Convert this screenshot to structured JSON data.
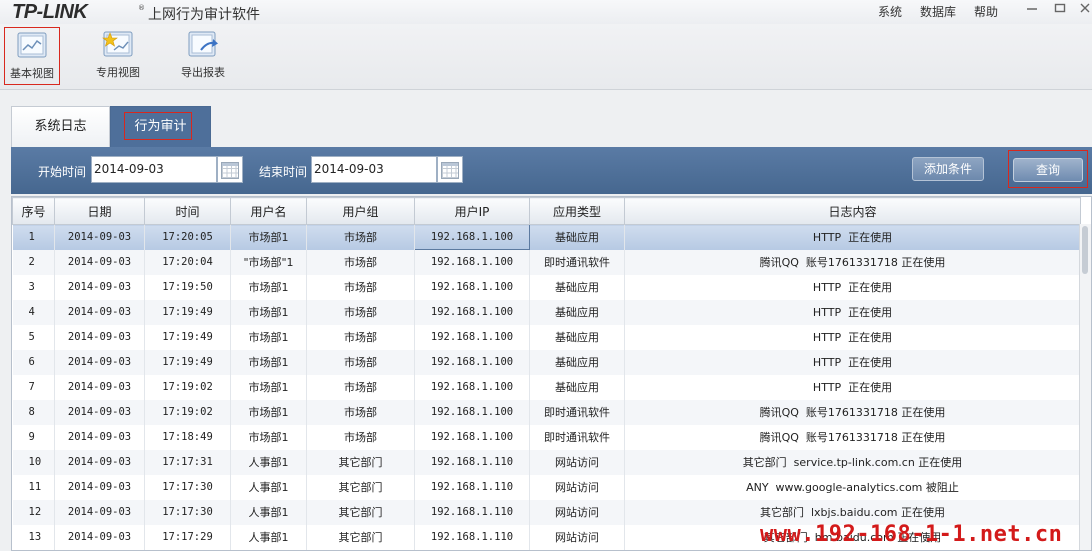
{
  "app": {
    "logo": "TP-LINK",
    "logo_mark": "®",
    "title": "上网行为审计软件",
    "menu": [
      "系统",
      "数据库",
      "帮助"
    ]
  },
  "toolbar": {
    "items": [
      {
        "label": "基本视图",
        "icon": "basic-view-icon"
      },
      {
        "label": "专用视图",
        "icon": "custom-view-icon"
      },
      {
        "label": "导出报表",
        "icon": "export-report-icon"
      }
    ]
  },
  "tabs": [
    {
      "label": "系统日志"
    },
    {
      "label": "行为审计"
    }
  ],
  "filter": {
    "start_label": "开始时间",
    "start_value": "2014-09-03",
    "end_label": "结束时间",
    "end_value": "2014-09-03",
    "add_condition": "添加条件",
    "query": "查询"
  },
  "table": {
    "columns": [
      "序号",
      "日期",
      "时间",
      "用户名",
      "用户组",
      "用户IP",
      "应用类型",
      "日志内容"
    ],
    "rows": [
      [
        "1",
        "2014-09-03",
        "17:20:05",
        "市场部1",
        "市场部",
        "192.168.1.100",
        "基础应用",
        "HTTP  正在使用"
      ],
      [
        "2",
        "2014-09-03",
        "17:20:04",
        "\"市场部\"1",
        "市场部",
        "192.168.1.100",
        "即时通讯软件",
        "腾讯QQ  账号1761331718 正在使用"
      ],
      [
        "3",
        "2014-09-03",
        "17:19:50",
        "市场部1",
        "市场部",
        "192.168.1.100",
        "基础应用",
        "HTTP  正在使用"
      ],
      [
        "4",
        "2014-09-03",
        "17:19:49",
        "市场部1",
        "市场部",
        "192.168.1.100",
        "基础应用",
        "HTTP  正在使用"
      ],
      [
        "5",
        "2014-09-03",
        "17:19:49",
        "市场部1",
        "市场部",
        "192.168.1.100",
        "基础应用",
        "HTTP  正在使用"
      ],
      [
        "6",
        "2014-09-03",
        "17:19:49",
        "市场部1",
        "市场部",
        "192.168.1.100",
        "基础应用",
        "HTTP  正在使用"
      ],
      [
        "7",
        "2014-09-03",
        "17:19:02",
        "市场部1",
        "市场部",
        "192.168.1.100",
        "基础应用",
        "HTTP  正在使用"
      ],
      [
        "8",
        "2014-09-03",
        "17:19:02",
        "市场部1",
        "市场部",
        "192.168.1.100",
        "即时通讯软件",
        "腾讯QQ  账号1761331718 正在使用"
      ],
      [
        "9",
        "2014-09-03",
        "17:18:49",
        "市场部1",
        "市场部",
        "192.168.1.100",
        "即时通讯软件",
        "腾讯QQ  账号1761331718 正在使用"
      ],
      [
        "10",
        "2014-09-03",
        "17:17:31",
        "人事部1",
        "其它部门",
        "192.168.1.110",
        "网站访问",
        "其它部门  service.tp-link.com.cn 正在使用"
      ],
      [
        "11",
        "2014-09-03",
        "17:17:30",
        "人事部1",
        "其它部门",
        "192.168.1.110",
        "网站访问",
        "ANY  www.google-analytics.com 被阻止"
      ],
      [
        "12",
        "2014-09-03",
        "17:17:30",
        "人事部1",
        "其它部门",
        "192.168.1.110",
        "网站访问",
        "其它部门  lxbjs.baidu.com 正在使用"
      ],
      [
        "13",
        "2014-09-03",
        "17:17:29",
        "人事部1",
        "其它部门",
        "192.168.1.110",
        "网站访问",
        "其它部门  hm.baidu.com 正在使用"
      ]
    ]
  },
  "watermark": "www.192-168-1-1.net.cn",
  "colors": {
    "accent_blue": "#4e6f9a",
    "highlight_red": "#d8281e",
    "selected_row": "#b6c9e3"
  }
}
